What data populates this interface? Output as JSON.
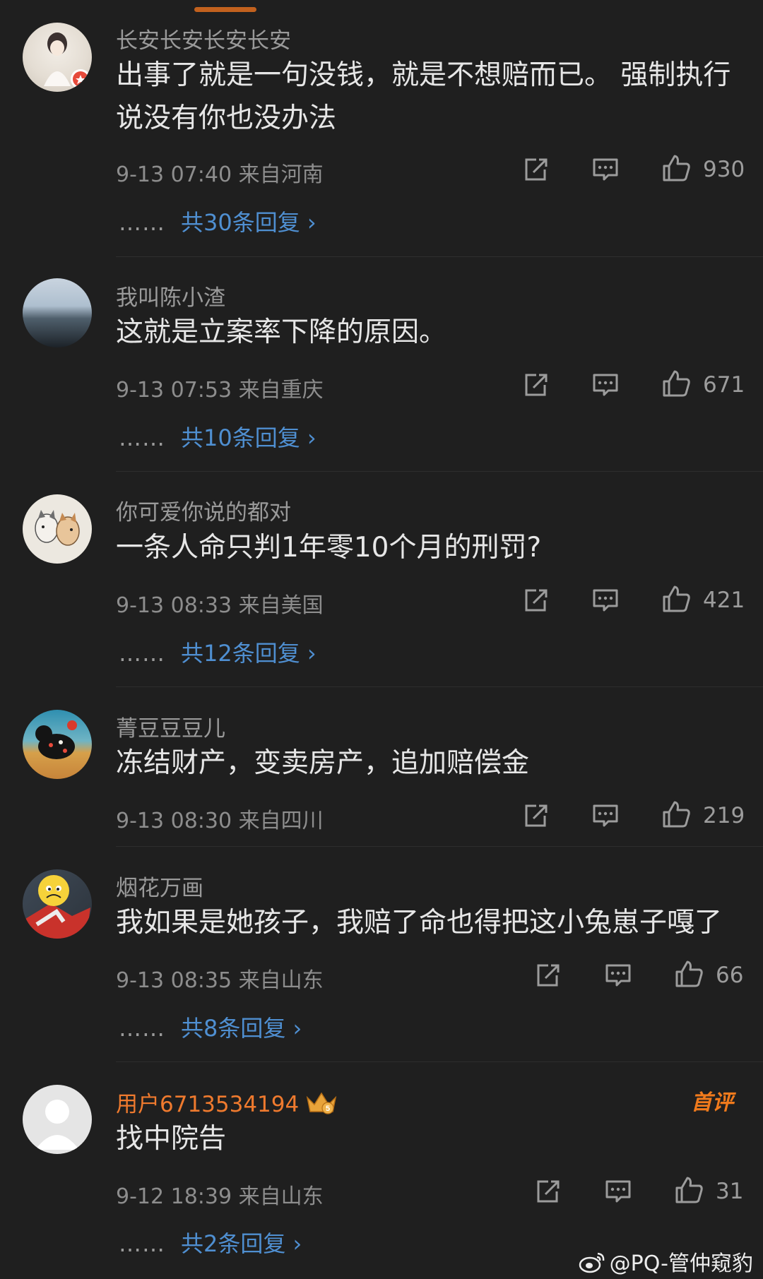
{
  "comments": [
    {
      "username": "长安长安长安长安",
      "text": "出事了就是一句没钱，就是不想赔而已。 强制执行说没有你也没办法",
      "time": "9-13 07:40",
      "location": "来自河南",
      "likes": "930",
      "replies": "共30条回复 ›"
    },
    {
      "username": "我叫陈小渣",
      "text": "这就是立案率下降的原因。",
      "time": "9-13 07:53",
      "location": "来自重庆",
      "likes": "671",
      "replies": "共10条回复 ›"
    },
    {
      "username": "你可爱你说的都对",
      "text": "一条人命只判1年零10个月的刑罚?",
      "time": "9-13 08:33",
      "location": "来自美国",
      "likes": "421",
      "replies": "共12条回复 ›"
    },
    {
      "username": "菁豆豆豆儿",
      "text": "冻结财产，变卖房产，追加赔偿金",
      "time": "9-13 08:30",
      "location": "来自四川",
      "likes": "219"
    },
    {
      "username": "烟花万画",
      "text": "我如果是她孩子，我赔了命也得把这小兔崽子嘎了",
      "time": "9-13 08:35",
      "location": "来自山东",
      "likes": "66",
      "replies": "共8条回复 ›"
    },
    {
      "username": "用户6713534194",
      "text": "找中院告",
      "time": "9-12 18:39",
      "location": "来自山东",
      "likes": "31",
      "replies": "共2条回复 ›",
      "badge": "首评",
      "crown_level": "5"
    }
  ],
  "reply_dots": "……",
  "watermark": "@PQ-管仲窥豹",
  "colors": {
    "background": "#1f1f1f",
    "link": "#4f8fd1",
    "username_vip": "#ef7a2e",
    "topbar": "#c2611e"
  }
}
